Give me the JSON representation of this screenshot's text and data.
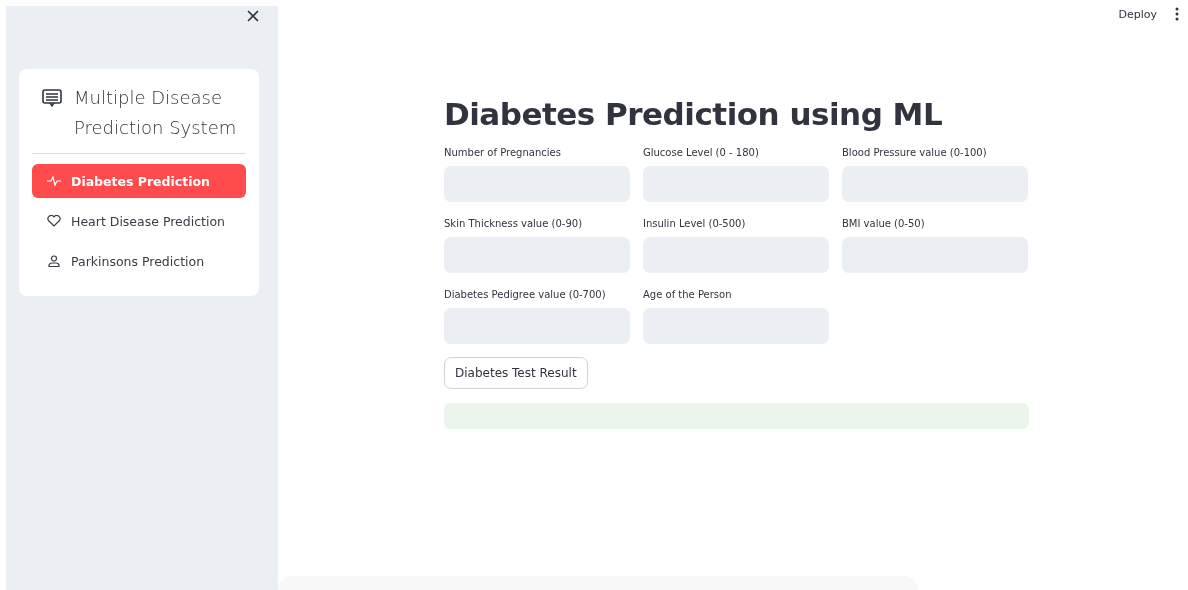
{
  "sidebar": {
    "title": "Multiple Disease Prediction System",
    "items": [
      {
        "label": "Diabetes Prediction",
        "kind": "pulse",
        "selected": true
      },
      {
        "label": "Heart Disease Prediction",
        "kind": "heart",
        "selected": false
      },
      {
        "label": "Parkinsons Prediction",
        "kind": "person",
        "selected": false
      }
    ]
  },
  "header": {
    "deploy": "Deploy"
  },
  "title": "Diabetes Prediction using ML",
  "fields": [
    {
      "label": "Number of Pregnancies"
    },
    {
      "label": "Glucose Level (0 - 180)"
    },
    {
      "label": "Blood Pressure value (0-100)"
    },
    {
      "label": "Skin Thickness value (0-90)"
    },
    {
      "label": "Insulin Level (0-500)"
    },
    {
      "label": "BMI value (0-50)"
    },
    {
      "label": "Diabetes Pedigree value (0-700)"
    },
    {
      "label": "Age of the Person"
    }
  ],
  "button": "Diabetes Test Result"
}
